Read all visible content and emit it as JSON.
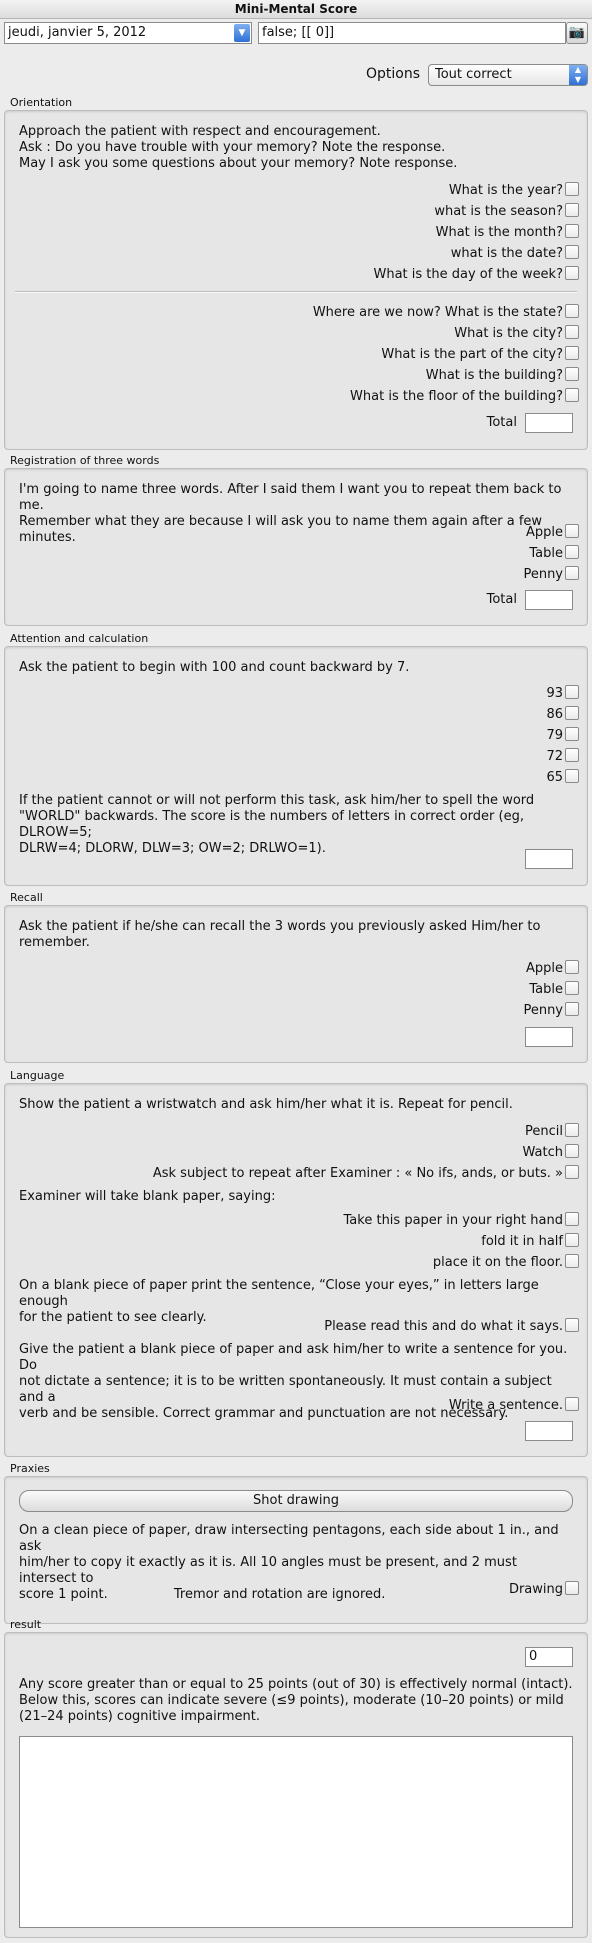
{
  "window": {
    "title": "Mini-Mental Score"
  },
  "toolbar": {
    "date": "jeudi, janvier 5, 2012",
    "value": "false; [[ 0]]",
    "camera_icon": "camera-icon"
  },
  "options": {
    "label": "Options",
    "selected": "Tout correct"
  },
  "orientation": {
    "title": "Orientation",
    "intro": [
      "Approach the patient with respect and encouragement.",
      "Ask : Do you have trouble with your memory? Note the response.",
      "May I ask you some questions about your memory? Note response."
    ],
    "time_questions": [
      "What is the year?",
      "what is the season?",
      "What is the month?",
      "what is the date?",
      "What is the day of the week?"
    ],
    "place_questions": [
      "Where are we now? What is the state?",
      "What is the city?",
      "What is the part of the city?",
      "What is the building?",
      "What is the floor of the building?"
    ],
    "total_label": "Total",
    "total_value": ""
  },
  "registration": {
    "title": "Registration of three words",
    "intro": [
      "I'm going to name three words. After I said them I want you to repeat them back to me.",
      "Remember what they are because I will ask you to name them again after a few minutes."
    ],
    "words": [
      "Apple",
      "Table",
      "Penny"
    ],
    "total_label": "Total",
    "total_value": ""
  },
  "attention": {
    "title": "Attention and calculation",
    "intro": "Ask the patient to begin with 100 and count backward by 7.",
    "numbers": [
      "93",
      "86",
      "79",
      "72",
      "65"
    ],
    "note": [
      "If the patient cannot or will not perform this task, ask him/her to spell the word",
      "\"WORLD\" backwards. The score is the numbers of letters in correct order (eg, DLROW=5;",
      "DLRW=4; DLORW, DLW=3; OW=2; DRLWO=1)."
    ],
    "score_value": ""
  },
  "recall": {
    "title": "Recall",
    "intro": [
      "Ask the patient if he/she can recall the 3 words you previously asked Him/her to",
      "remember."
    ],
    "words": [
      "Apple",
      "Table",
      "Penny"
    ],
    "score_value": ""
  },
  "language": {
    "title": "Language",
    "intro": "Show the patient a wristwatch and ask him/her what it is. Repeat for pencil.",
    "objects": [
      "Pencil",
      "Watch"
    ],
    "repeat": "Ask subject to repeat after Examiner : « No ifs, ands, or buts. »",
    "paper_intro": "Examiner will take blank paper, saying:",
    "paper_steps": [
      "Take this paper in your right hand",
      "fold it in half",
      "place it on the floor."
    ],
    "close_eyes": [
      "On a blank piece of paper print the sentence, “Close your eyes,” in letters large enough",
      "for the patient to see clearly."
    ],
    "read_label": "Please read this and do what it says.",
    "sentence_text": [
      "Give the patient a blank piece of paper and ask him/her to write a sentence for you. Do",
      "not dictate a sentence; it is to be written spontaneously. It must contain a subject and a",
      "verb and be sensible. Correct grammar and punctuation are not necessary."
    ],
    "write_label": "Write a sentence.",
    "score_value": ""
  },
  "praxies": {
    "title": "Praxies",
    "button_label": "Shot drawing",
    "text": [
      "On a clean piece of paper, draw intersecting pentagons, each side about 1 in., and ask",
      "him/her to copy it exactly as it is. All 10 angles must be present, and 2 must intersect to",
      "score 1 point.                Tremor and rotation are ignored."
    ],
    "drawing_label": "Drawing"
  },
  "result": {
    "title": "result",
    "score": "0",
    "text": [
      "Any score greater than or equal to 25 points (out of 30) is effectively normal (intact).",
      "Below this, scores can indicate severe (≤9 points), moderate (10–20 points) or mild",
      "(21–24 points) cognitive impairment."
    ],
    "notes": ""
  }
}
